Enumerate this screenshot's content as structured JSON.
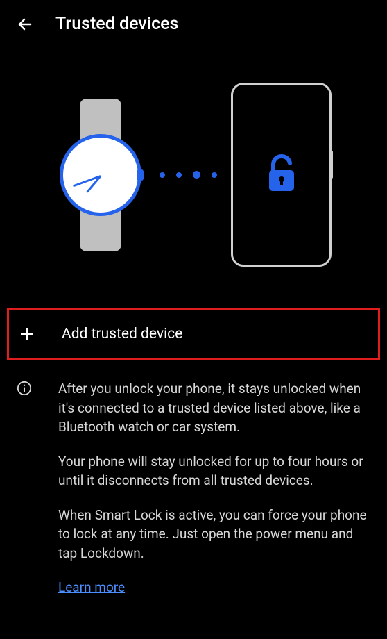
{
  "header": {
    "title": "Trusted devices"
  },
  "action": {
    "add_label": "Add trusted device"
  },
  "info": {
    "paragraph1": "After you unlock your phone, it stays unlocked when it's connected to a trusted device listed above, like a Bluetooth watch or car system.",
    "paragraph2": "Your phone will stay unlocked for up to four hours or until it disconnects from all trusted devices.",
    "paragraph3": "When Smart Lock is active, you can force your phone to lock at any time. Just open the power menu and tap Lockdown.",
    "learn_more": "Learn more"
  },
  "colors": {
    "accent": "#2563eb",
    "highlight_border": "#e11d1d",
    "link": "#4a8eff"
  }
}
